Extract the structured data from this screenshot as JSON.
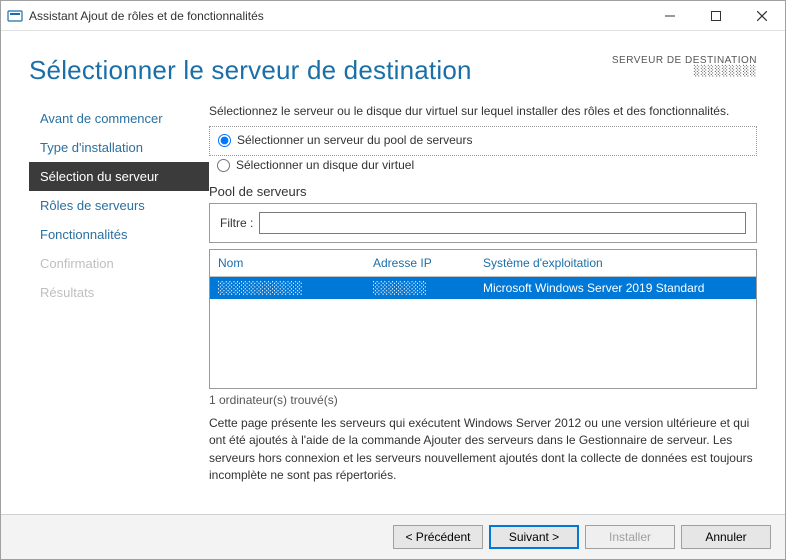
{
  "window": {
    "title": "Assistant Ajout de rôles et de fonctionnalités"
  },
  "header": {
    "title": "Sélectionner le serveur de destination",
    "dest_label": "SERVEUR DE DESTINATION",
    "dest_server": "░░░░░░░░░"
  },
  "steps": [
    {
      "label": "Avant de commencer",
      "state": "normal"
    },
    {
      "label": "Type d'installation",
      "state": "normal"
    },
    {
      "label": "Sélection du serveur",
      "state": "active"
    },
    {
      "label": "Rôles de serveurs",
      "state": "normal"
    },
    {
      "label": "Fonctionnalités",
      "state": "normal"
    },
    {
      "label": "Confirmation",
      "state": "disabled"
    },
    {
      "label": "Résultats",
      "state": "disabled"
    }
  ],
  "main": {
    "intro": "Sélectionnez le serveur ou le disque dur virtuel sur lequel installer des rôles et des fonctionnalités.",
    "radio_pool": "Sélectionner un serveur du pool de serveurs",
    "radio_vhd": "Sélectionner un disque dur virtuel",
    "pool_label": "Pool de serveurs",
    "filter_label": "Filtre :",
    "filter_value": "",
    "columns": {
      "nom": "Nom",
      "ip": "Adresse IP",
      "os": "Système d'exploitation"
    },
    "rows": [
      {
        "nom": "░░░░░░░░░░░",
        "ip": "░░░░░░░",
        "os": "Microsoft Windows Server 2019 Standard"
      }
    ],
    "found": "1 ordinateur(s) trouvé(s)",
    "desc": "Cette page présente les serveurs qui exécutent Windows Server 2012 ou une version ultérieure et qui ont été ajoutés à l'aide de la commande Ajouter des serveurs dans le Gestionnaire de serveur. Les serveurs hors connexion et les serveurs nouvellement ajoutés dont la collecte de données est toujours incomplète ne sont pas répertoriés."
  },
  "footer": {
    "prev": "< Précédent",
    "next": "Suivant >",
    "install": "Installer",
    "cancel": "Annuler"
  }
}
